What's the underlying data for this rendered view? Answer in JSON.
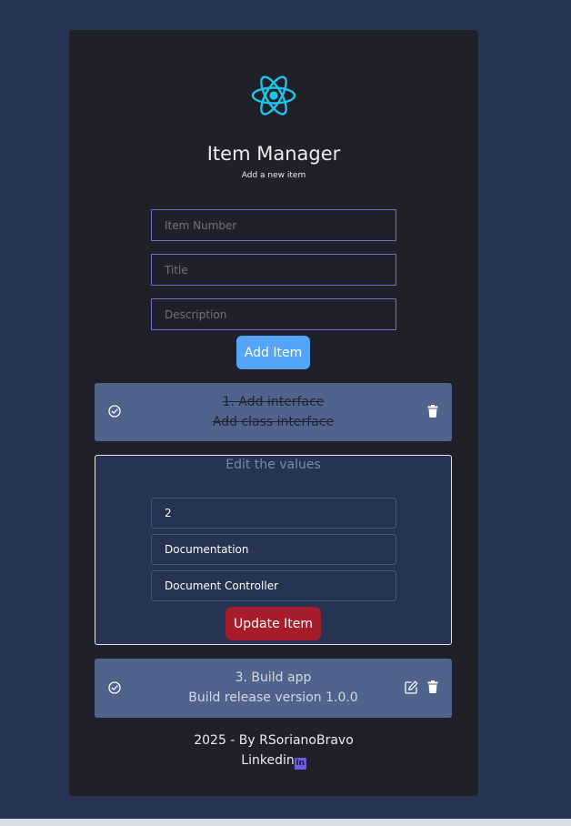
{
  "header": {
    "title": "Item Manager",
    "subtitle": "Add a new item",
    "logo_icon": "react-logo-icon"
  },
  "form": {
    "item_number_placeholder": "Item Number",
    "title_placeholder": "Title",
    "description_placeholder": "Description",
    "add_label": "Add Item"
  },
  "items": [
    {
      "number_title": "1. Add interface",
      "description": "Add class interface",
      "completed": true,
      "icons": [
        "check-circle-icon",
        "trash-icon"
      ]
    },
    {
      "number_title": "3. Build app",
      "description": "Build release version 1.0.0",
      "completed": false,
      "icons": [
        "check-circle-icon",
        "edit-icon",
        "trash-icon"
      ]
    }
  ],
  "edit": {
    "heading": "Edit the values",
    "number_value": "2",
    "title_value": "Documentation",
    "description_value": "Document Controller",
    "update_label": "Update Item"
  },
  "footer": {
    "credit": "2025 - By RSorianoBravo",
    "link_label": "Linkedin",
    "link_badge": "in"
  },
  "colors": {
    "background": "#263352",
    "card": "#202028",
    "accent_blue": "#54a5f7",
    "danger": "#a51c2a",
    "item_bg": "#4f638c",
    "react_cyan": "#1fc4e8"
  }
}
